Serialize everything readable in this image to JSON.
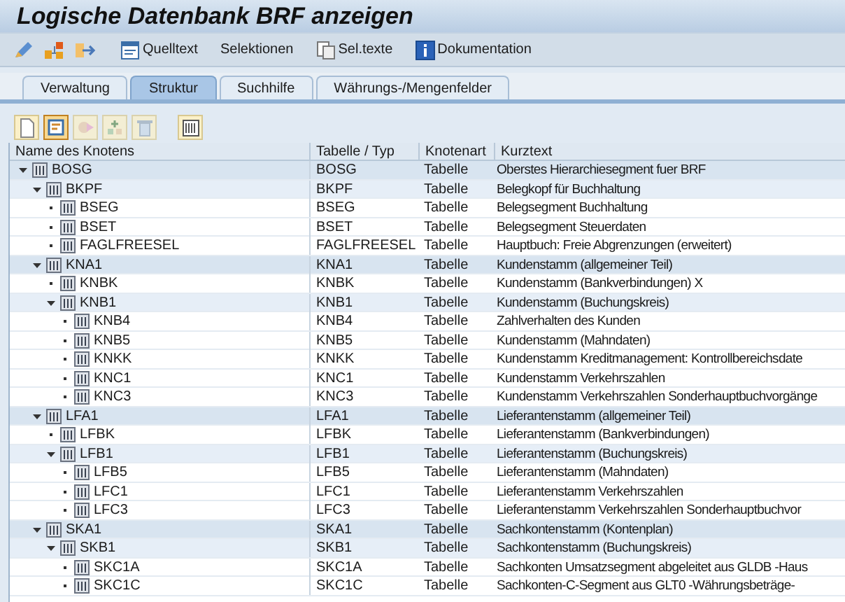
{
  "window": {
    "title": "Logische Datenbank BRF anzeigen"
  },
  "toolbar": [
    {
      "kind": "icon"
    },
    {
      "kind": "icon"
    },
    {
      "kind": "icon"
    },
    {
      "kind": "button",
      "label": "Quelltext"
    },
    {
      "kind": "button",
      "label": "Selektionen"
    },
    {
      "kind": "button",
      "label": "Sel.texte"
    },
    {
      "kind": "button",
      "label": "Dokumentation"
    }
  ],
  "tabs": [
    {
      "label": "Verwaltung",
      "selected": false
    },
    {
      "label": "Struktur",
      "selected": true
    },
    {
      "label": "Suchhilfe",
      "selected": false
    },
    {
      "label": "Währungs-/Mengenfelder",
      "selected": false
    }
  ],
  "tree_tools": [
    {
      "disabled": false,
      "selected": false
    },
    {
      "disabled": false,
      "selected": true
    },
    {
      "disabled": true,
      "selected": false
    },
    {
      "disabled": true,
      "selected": false
    },
    {
      "disabled": true,
      "selected": false
    },
    {
      "disabled": false,
      "selected": false
    }
  ],
  "tree": {
    "columns": [
      "Name des Knotens",
      "Tabelle / Typ",
      "Knotenart",
      "Kurztext"
    ],
    "nodes": [
      {
        "name": "BOSG",
        "table": "BOSG",
        "type": "Tabelle",
        "text": "Oberstes Hierarchiesegment fuer BRF",
        "expanded": true,
        "children": [
          {
            "name": "BKPF",
            "table": "BKPF",
            "type": "Tabelle",
            "text": "Belegkopf für Buchhaltung",
            "expanded": true,
            "children": [
              {
                "name": "BSEG",
                "table": "BSEG",
                "type": "Tabelle",
                "text": "Belegsegment Buchhaltung"
              },
              {
                "name": "BSET",
                "table": "BSET",
                "type": "Tabelle",
                "text": "Belegsegment Steuerdaten"
              },
              {
                "name": "FAGLFREESEL",
                "table": "FAGLFREESEL",
                "type": "Tabelle",
                "text": "Hauptbuch: Freie Abgrenzungen (erweitert)"
              }
            ]
          },
          {
            "name": "KNA1",
            "table": "KNA1",
            "type": "Tabelle",
            "text": "Kundenstamm (allgemeiner Teil)",
            "expanded": true,
            "children": [
              {
                "name": "KNBK",
                "table": "KNBK",
                "type": "Tabelle",
                "text": "Kundenstamm (Bankverbindungen) X"
              },
              {
                "name": "KNB1",
                "table": "KNB1",
                "type": "Tabelle",
                "text": "Kundenstamm (Buchungskreis)",
                "expanded": true,
                "children": [
                  {
                    "name": "KNB4",
                    "table": "KNB4",
                    "type": "Tabelle",
                    "text": "Zahlverhalten des Kunden"
                  },
                  {
                    "name": "KNB5",
                    "table": "KNB5",
                    "type": "Tabelle",
                    "text": "Kundenstamm (Mahndaten)"
                  },
                  {
                    "name": "KNKK",
                    "table": "KNKK",
                    "type": "Tabelle",
                    "text": "Kundenstamm Kreditmanagement: Kontrollbereichsdate"
                  },
                  {
                    "name": "KNC1",
                    "table": "KNC1",
                    "type": "Tabelle",
                    "text": "Kundenstamm Verkehrszahlen"
                  },
                  {
                    "name": "KNC3",
                    "table": "KNC3",
                    "type": "Tabelle",
                    "text": "Kundenstamm Verkehrszahlen Sonderhauptbuchvorgänge"
                  }
                ]
              }
            ]
          },
          {
            "name": "LFA1",
            "table": "LFA1",
            "type": "Tabelle",
            "text": "Lieferantenstamm (allgemeiner Teil)",
            "expanded": true,
            "children": [
              {
                "name": "LFBK",
                "table": "LFBK",
                "type": "Tabelle",
                "text": "Lieferantenstamm (Bankverbindungen)"
              },
              {
                "name": "LFB1",
                "table": "LFB1",
                "type": "Tabelle",
                "text": "Lieferantenstamm (Buchungskreis)",
                "expanded": true,
                "children": [
                  {
                    "name": "LFB5",
                    "table": "LFB5",
                    "type": "Tabelle",
                    "text": "Lieferantenstamm (Mahndaten)"
                  },
                  {
                    "name": "LFC1",
                    "table": "LFC1",
                    "type": "Tabelle",
                    "text": "Lieferantenstamm Verkehrszahlen"
                  },
                  {
                    "name": "LFC3",
                    "table": "LFC3",
                    "type": "Tabelle",
                    "text": "Lieferantenstamm Verkehrszahlen Sonderhauptbuchvor"
                  }
                ]
              }
            ]
          },
          {
            "name": "SKA1",
            "table": "SKA1",
            "type": "Tabelle",
            "text": "Sachkontenstamm (Kontenplan)",
            "expanded": true,
            "children": [
              {
                "name": "SKB1",
                "table": "SKB1",
                "type": "Tabelle",
                "text": "Sachkontenstamm (Buchungskreis)",
                "expanded": true,
                "children": [
                  {
                    "name": "SKC1A",
                    "table": "SKC1A",
                    "type": "Tabelle",
                    "text": "Sachkonten Umsatzsegment abgeleitet aus GLDB -Haus"
                  },
                  {
                    "name": "SKC1C",
                    "table": "SKC1C",
                    "type": "Tabelle",
                    "text": "Sachkonten-C-Segment aus GLT0  -Währungsbeträge-"
                  }
                ]
              }
            ]
          }
        ]
      }
    ]
  }
}
